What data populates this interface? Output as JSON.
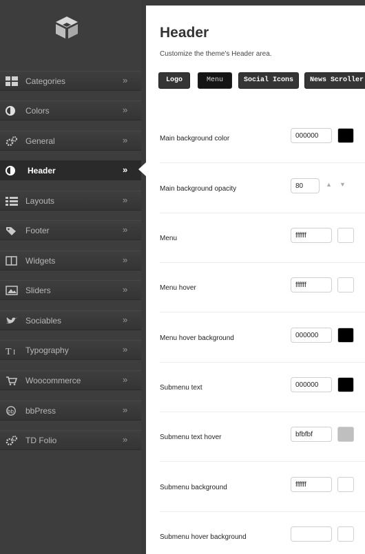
{
  "sidebar": {
    "items": [
      {
        "label": "Categories",
        "icon": "categories-grid-icon"
      },
      {
        "label": "Colors",
        "icon": "colors-contrast-icon"
      },
      {
        "label": "General",
        "icon": "general-gears-icon"
      },
      {
        "label": "Header",
        "icon": "header-contrast-icon"
      },
      {
        "label": "Layouts",
        "icon": "layouts-list-icon"
      },
      {
        "label": "Footer",
        "icon": "footer-tag-icon"
      },
      {
        "label": "Widgets",
        "icon": "widgets-columns-icon"
      },
      {
        "label": "Sliders",
        "icon": "sliders-image-icon"
      },
      {
        "label": "Sociables",
        "icon": "sociables-bird-icon"
      },
      {
        "label": "Typography",
        "icon": "typography-icon"
      },
      {
        "label": "Woocommerce",
        "icon": "woocommerce-cart-icon"
      },
      {
        "label": "bbPress",
        "icon": "bbpress-icon"
      },
      {
        "label": "TD Folio",
        "icon": "td-folio-gears-icon"
      }
    ],
    "arrow": "»",
    "active_index": 3
  },
  "panel": {
    "title": "Header",
    "subtitle": "Customize the theme's Header area.",
    "tabs": [
      {
        "label": "Logo"
      },
      {
        "label": "Menu"
      },
      {
        "label": "Social Icons"
      },
      {
        "label": "News Scroller"
      }
    ],
    "active_tab": 1,
    "settings": [
      {
        "label": "Main background color",
        "value": "000000",
        "swatch": "#000000"
      },
      {
        "label": "Main background opacity",
        "value": "80",
        "up": "▲",
        "down": "▼"
      },
      {
        "label": "Menu",
        "value": "ffffff",
        "swatch": "#ffffff"
      },
      {
        "label": "Menu hover",
        "value": "ffffff",
        "swatch": "#ffffff"
      },
      {
        "label": "Menu hover background",
        "value": "000000",
        "swatch": "#000000"
      },
      {
        "label": "Submenu text",
        "value": "000000",
        "swatch": "#000000"
      },
      {
        "label": "Submenu text hover",
        "value": "bfbfbf",
        "swatch": "#bfbfbf"
      },
      {
        "label": "Submenu background",
        "value": "ffffff",
        "swatch": "#ffffff"
      },
      {
        "label": "Submenu hover background",
        "value": "",
        "swatch": "#ffffff"
      }
    ]
  }
}
